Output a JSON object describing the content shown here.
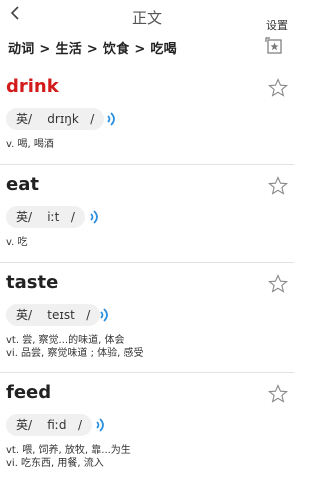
{
  "header": {
    "title": "正文",
    "settings_label": "设置"
  },
  "breadcrumb": "动词 > 生活 > 饮食 > 吃喝",
  "colors": {
    "highlight_word": "#d31b1b",
    "speaker_blue": "#2b8fe0"
  },
  "words": [
    {
      "word": "drink",
      "phonetic": "英/    drɪŋk   /",
      "definitions": [
        "v.  喝, 喝酒"
      ]
    },
    {
      "word": "eat",
      "phonetic": "英/    iːt   /",
      "definitions": [
        "v.  吃"
      ]
    },
    {
      "word": "taste",
      "phonetic": "英/    teɪst   /",
      "definitions": [
        "vt.  尝, 察觉...的味道, 体会",
        "vi.  品尝, 察觉味道 ; 体验, 感受"
      ]
    },
    {
      "word": "feed",
      "phonetic": "英/    fiːd   /",
      "definitions": [
        "vt.  喂, 饲养, 放牧, 靠...为生",
        "vi.  吃东西, 用餐, 流入"
      ]
    }
  ]
}
